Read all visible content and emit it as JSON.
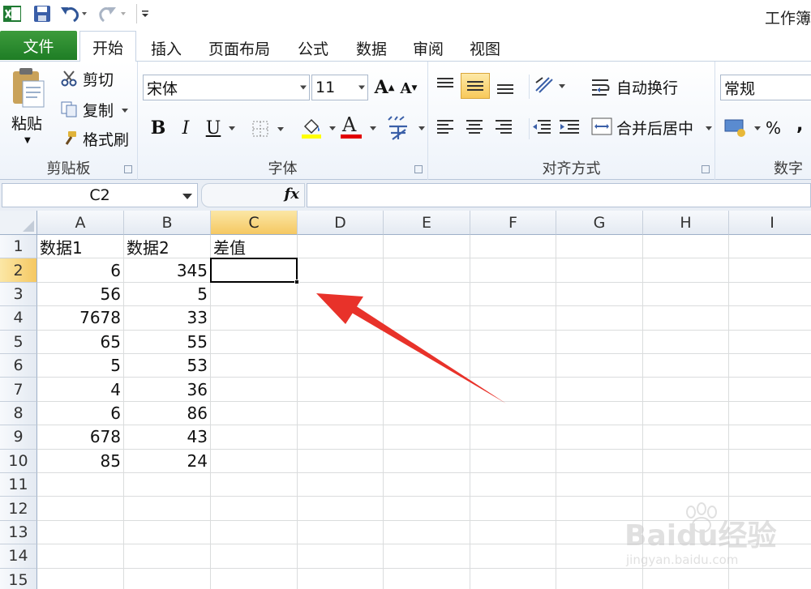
{
  "app": {
    "title": "工作簿"
  },
  "tabs": [
    "文件",
    "开始",
    "插入",
    "页面布局",
    "公式",
    "数据",
    "审阅",
    "视图"
  ],
  "clipboard": {
    "paste": "粘贴",
    "cut": "剪切",
    "copy": "复制",
    "format_painter": "格式刷",
    "label": "剪贴板"
  },
  "font": {
    "name": "宋体",
    "size": "11",
    "label": "字体",
    "bold": "B",
    "italic": "I",
    "underline": "U"
  },
  "alignment": {
    "wrap_text": "自动换行",
    "merge_center": "合并后居中",
    "label": "对齐方式"
  },
  "number": {
    "format": "常规",
    "label": "数字",
    "percent": "%",
    "comma": ","
  },
  "formula_bar": {
    "name_box": "C2",
    "fx": "fx",
    "formula": ""
  },
  "columns": [
    "A",
    "B",
    "C",
    "D",
    "E",
    "F",
    "G",
    "H",
    "I"
  ],
  "rows": [
    "1",
    "2",
    "3",
    "4",
    "5",
    "6",
    "7",
    "8",
    "9",
    "10",
    "11",
    "12",
    "13",
    "14",
    "15"
  ],
  "selected": {
    "column": "C",
    "row": "2"
  },
  "cells": {
    "headers": [
      "数据1",
      "数据2",
      "差值"
    ],
    "data1": [
      "6",
      "56",
      "7678",
      "65",
      "5",
      "4",
      "6",
      "678",
      "85"
    ],
    "data2": [
      "345",
      "5",
      "33",
      "55",
      "53",
      "36",
      "86",
      "43",
      "24"
    ]
  },
  "colors": {
    "file_tab": "#2a8a2e",
    "arrow": "#e8322a",
    "selection_header": "#f5c862"
  },
  "watermark": {
    "main": "Baidu经验",
    "sub": "jingyan.baidu.com"
  }
}
